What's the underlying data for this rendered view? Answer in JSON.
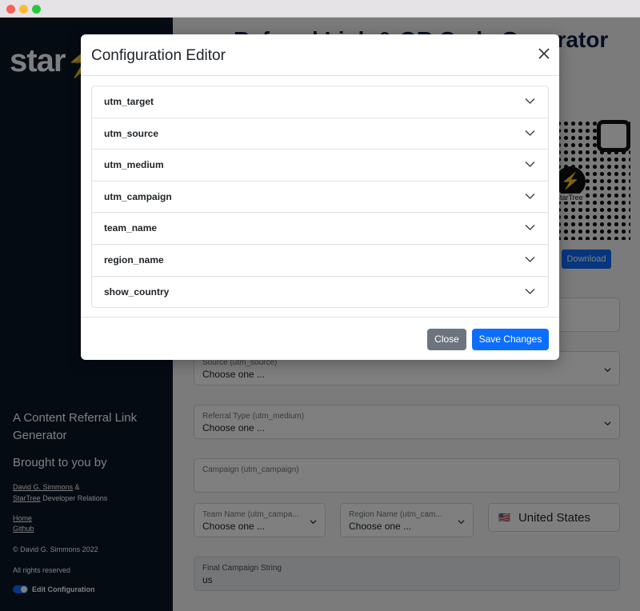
{
  "sidebar": {
    "logo": "star",
    "tagline": "A Content Referral Link Generator",
    "brought_by": "Brought to you by",
    "author_link": "David G. Simmons",
    "author_amp": "&",
    "company_link": "StarTree",
    "company_suffix": "Developer Relations",
    "nav_home": "Home",
    "nav_github": "Github",
    "copyright": "© David G. Simmons 2022",
    "rights": "All rights reserved",
    "toggle_label": "Edit Configuration",
    "toggle_on": true
  },
  "main": {
    "title": "Referral Link & QR Code Generator",
    "qr_brand_text": "StarTree",
    "download_label": "Download",
    "fields": {
      "source_label": "Source (utm_source)",
      "source_value": "Choose one ...",
      "medium_label": "Referral Type (utm_medium)",
      "medium_value": "Choose one ...",
      "campaign_label": "Campaign (utm_campaign)",
      "campaign_value": "",
      "team_label": "Team Name (utm_campa...",
      "team_value": "Choose one ...",
      "region_label": "Region Name (utm_cam...",
      "region_value": "Choose one ...",
      "country_flag": "🇺🇸",
      "country_value": "United States",
      "final_label": "Final Campaign String",
      "final_value": "us"
    }
  },
  "modal": {
    "title": "Configuration Editor",
    "accordion": [
      "utm_target",
      "utm_source",
      "utm_medium",
      "utm_campaign",
      "team_name",
      "region_name",
      "show_country"
    ],
    "close_label": "Close",
    "save_label": "Save Changes"
  },
  "colors": {
    "sidebar_bg": "#0b1627",
    "primary": "#0d6efd",
    "secondary": "#6c757d"
  }
}
